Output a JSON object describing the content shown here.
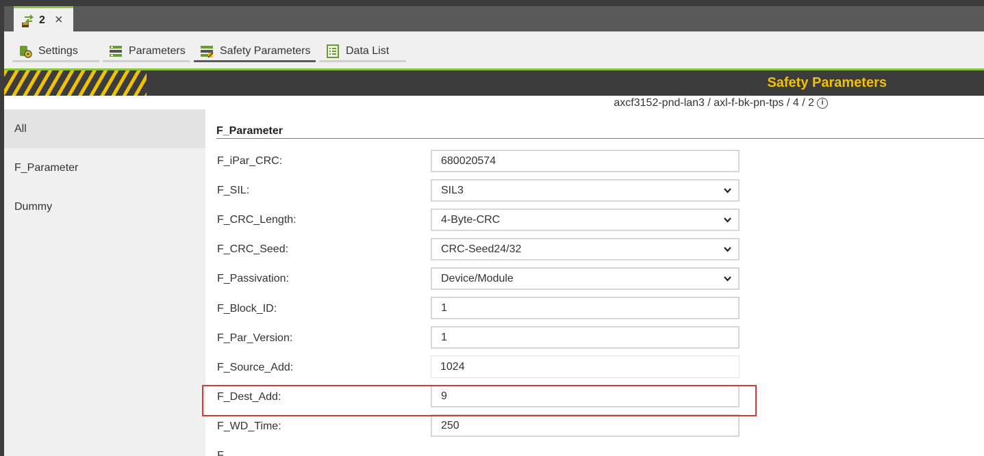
{
  "window_tab": {
    "title": "2",
    "close": "×"
  },
  "editor_tabs": [
    {
      "label": "Settings",
      "icon": "settings-gear-icon",
      "active": false
    },
    {
      "label": "Parameters",
      "icon": "parameters-list-icon",
      "active": false
    },
    {
      "label": "Safety Parameters",
      "icon": "safety-parameters-icon",
      "active": true
    },
    {
      "label": "Data List",
      "icon": "data-list-icon",
      "active": false
    }
  ],
  "header": {
    "title": "Safety Parameters",
    "breadcrumb": "axcf3152-pnd-lan3 / axl-f-bk-pn-tps / 4 / 2",
    "info_icon": "i"
  },
  "nav": {
    "items": [
      {
        "label": "All",
        "selected": true
      },
      {
        "label": "F_Parameter",
        "selected": false
      },
      {
        "label": "Dummy",
        "selected": false
      }
    ]
  },
  "section": {
    "title": "F_Parameter",
    "rows": [
      {
        "label": "F_iPar_CRC:",
        "value": "680020574",
        "type": "text"
      },
      {
        "label": "F_SIL:",
        "value": "SIL3",
        "type": "select"
      },
      {
        "label": "F_CRC_Length:",
        "value": "4-Byte-CRC",
        "type": "select"
      },
      {
        "label": "F_CRC_Seed:",
        "value": "CRC-Seed24/32",
        "type": "select"
      },
      {
        "label": "F_Passivation:",
        "value": "Device/Module",
        "type": "select"
      },
      {
        "label": "F_Block_ID:",
        "value": "1",
        "type": "text"
      },
      {
        "label": "F_Par_Version:",
        "value": "1",
        "type": "text"
      },
      {
        "label": "F_Source_Add:",
        "value": "1024",
        "type": "readonly"
      },
      {
        "label": "F_Dest_Add:",
        "value": "9",
        "type": "text"
      },
      {
        "label": "F_WD_Time:",
        "value": "250",
        "type": "text"
      }
    ],
    "partial_next_label": "F"
  },
  "colors": {
    "accent_green": "#8cc63f",
    "hazard_yellow": "#f2c200",
    "dark": "#3c3c3c",
    "highlight_red": "#d43a3a"
  }
}
